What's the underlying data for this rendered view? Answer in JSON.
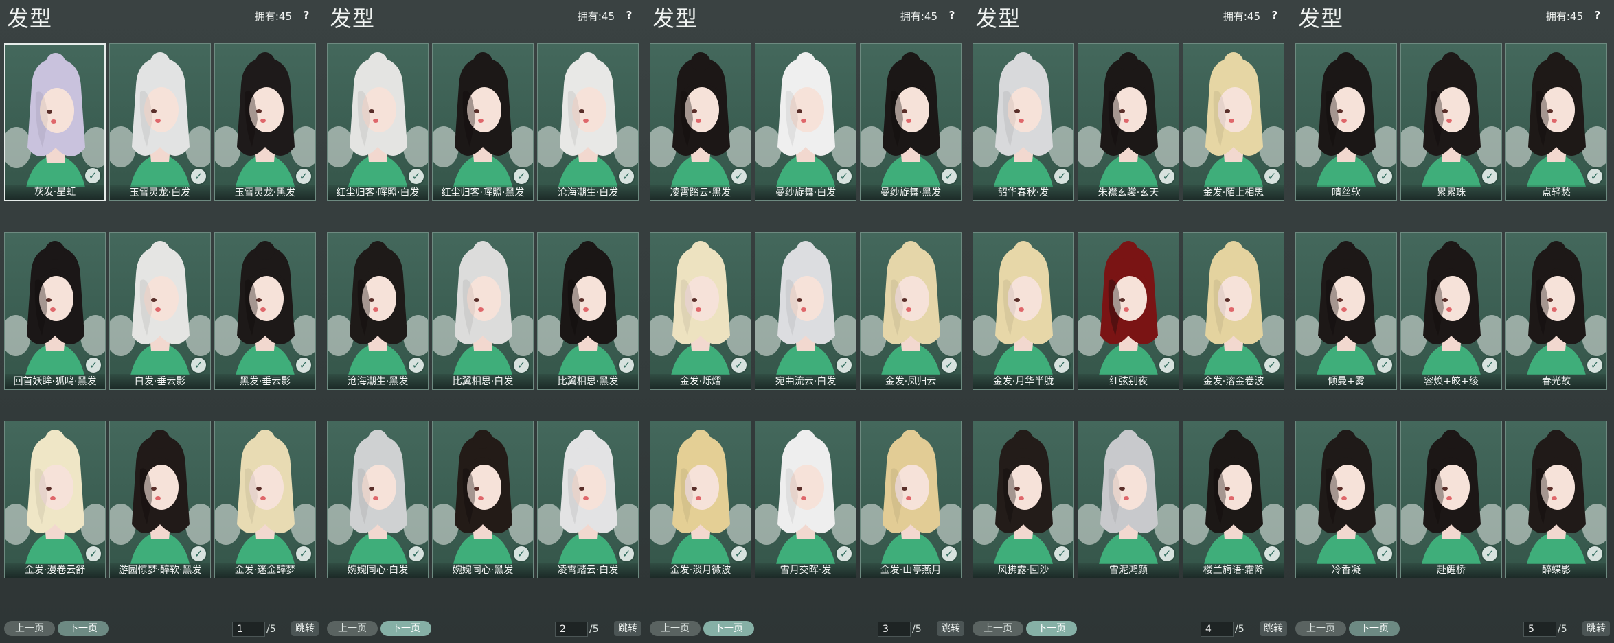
{
  "colors": {
    "card_bg": "#3b5e52",
    "card_border": "#6d8a80",
    "panel_bg": "#333b3b",
    "check": "#d7e2de",
    "next_button": "#86b0a6"
  },
  "panels": [
    {
      "title": "发型",
      "own": "拥有:45",
      "help": "?",
      "items": [
        {
          "label": "灰发·星虹",
          "hair": "#c9c2dd",
          "selected": true
        },
        {
          "label": "玉雪灵龙·白发",
          "hair": "#e2e3e3"
        },
        {
          "label": "玉雪灵龙·黑发",
          "hair": "#1e1a1a"
        },
        {
          "label": "回首妖眸·狐鸣·黑发",
          "hair": "#1b1717"
        },
        {
          "label": "白发·垂云影",
          "hair": "#e5e5e3"
        },
        {
          "label": "黑发·垂云影",
          "hair": "#1d1918"
        },
        {
          "label": "金发·漫卷云舒",
          "hair": "#efe6c6"
        },
        {
          "label": "游园惊梦·醉软·黑发",
          "hair": "#211a18"
        },
        {
          "label": "金发·迷金醉梦",
          "hair": "#e8dbb3"
        }
      ],
      "prev": "上一页",
      "next": "下一页",
      "page": "1",
      "total": "/5",
      "jump": "跳转",
      "next_active": false
    },
    {
      "title": "发型",
      "own": "拥有:45",
      "help": "?",
      "items": [
        {
          "label": "红尘归客·晖照·白发",
          "hair": "#e4e4e2"
        },
        {
          "label": "红尘归客·晖照·黑发",
          "hair": "#1c1817"
        },
        {
          "label": "沧海潮生·白发",
          "hair": "#e8e8e6"
        },
        {
          "label": "沧海潮生·黑发",
          "hair": "#1e1a18"
        },
        {
          "label": "比翼相思·白发",
          "hair": "#dcdcdb"
        },
        {
          "label": "比翼相思·黑发",
          "hair": "#1a1615"
        },
        {
          "label": "婉婉同心·白发",
          "hair": "#cfd1d2"
        },
        {
          "label": "婉婉同心·黑发",
          "hair": "#231b17"
        },
        {
          "label": "凌霄踏云·白发",
          "hair": "#e3e3e4"
        }
      ],
      "prev": "上一页",
      "next": "下一页",
      "page": "2",
      "total": "/5",
      "jump": "跳转",
      "next_active": true
    },
    {
      "title": "发型",
      "own": "拥有:45",
      "help": "?",
      "items": [
        {
          "label": "凌霄踏云·黑发",
          "hair": "#1c1716"
        },
        {
          "label": "曼纱旋舞·白发",
          "hair": "#efefef"
        },
        {
          "label": "曼纱旋舞·黑发",
          "hair": "#1b1716"
        },
        {
          "label": "金发·烁熠",
          "hair": "#ede2c0"
        },
        {
          "label": "宛曲流云·白发",
          "hair": "#dcdde0"
        },
        {
          "label": "金发·凤归云",
          "hair": "#e5d6a9"
        },
        {
          "label": "金发·淡月微波",
          "hair": "#e4cf95"
        },
        {
          "label": "雪月交晖·发",
          "hair": "#eeeeee"
        },
        {
          "label": "金发·山亭燕月",
          "hair": "#e2cc95"
        }
      ],
      "prev": "上一页",
      "next": "下一页",
      "page": "3",
      "total": "/5",
      "jump": "跳转",
      "next_active": true
    },
    {
      "title": "发型",
      "own": "拥有:45",
      "help": "?",
      "items": [
        {
          "label": "韶华春秋·发",
          "hair": "#d8d9db"
        },
        {
          "label": "朱襟玄裳·玄天",
          "hair": "#1c1817"
        },
        {
          "label": "金发·陌上相思",
          "hair": "#e6d6a4"
        },
        {
          "label": "金发·月华半胧",
          "hair": "#e7d7a8"
        },
        {
          "label": "红弦别夜",
          "hair": "#7a1414"
        },
        {
          "label": "金发·溶金卷波",
          "hair": "#e4d39f"
        },
        {
          "label": "风拂露·回沙",
          "hair": "#231c19"
        },
        {
          "label": "雪泥鸿颜",
          "hair": "#c8c9cc"
        },
        {
          "label": "楼兰旖语·霜降",
          "hair": "#1c1816"
        }
      ],
      "prev": "上一页",
      "next": "下一页",
      "page": "4",
      "total": "/5",
      "jump": "跳转",
      "next_active": true
    },
    {
      "title": "发型",
      "own": "拥有:45",
      "help": "?",
      "items": [
        {
          "label": "晴丝软",
          "hair": "#1b1716"
        },
        {
          "label": "累累珠",
          "hair": "#1d1817"
        },
        {
          "label": "点轻愁",
          "hair": "#1e1917"
        },
        {
          "label": "倾曼+雾",
          "hair": "#1d1817"
        },
        {
          "label": "容焕+皎+绫",
          "hair": "#1c1716"
        },
        {
          "label": "春光故",
          "hair": "#1d1817"
        },
        {
          "label": "冷香凝",
          "hair": "#1f1a18"
        },
        {
          "label": "赴鲤桥",
          "hair": "#1c1716"
        },
        {
          "label": "醉蝶影",
          "hair": "#201a18"
        }
      ],
      "prev": "上一页",
      "next": "下一页",
      "page": "5",
      "total": "/5",
      "jump": "跳转",
      "next_active": false
    }
  ]
}
